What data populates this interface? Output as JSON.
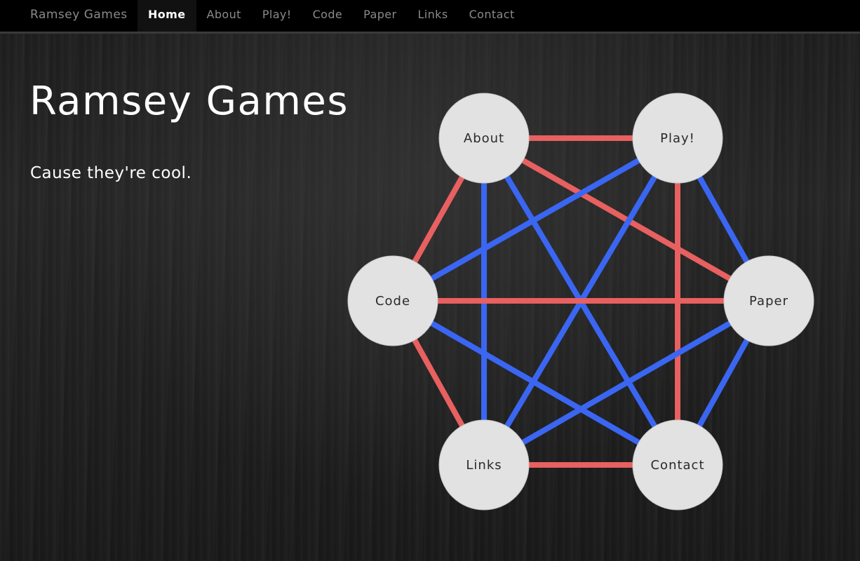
{
  "navbar": {
    "brand": "Ramsey Games",
    "items": [
      {
        "label": "Home",
        "active": true
      },
      {
        "label": "About",
        "active": false
      },
      {
        "label": "Play!",
        "active": false
      },
      {
        "label": "Code",
        "active": false
      },
      {
        "label": "Paper",
        "active": false
      },
      {
        "label": "Links",
        "active": false
      },
      {
        "label": "Contact",
        "active": false
      }
    ]
  },
  "hero": {
    "title": "Ramsey Games",
    "subtitle": "Cause they're cool."
  },
  "colors": {
    "red_edge": "#e86060",
    "blue_edge": "#3a66f2",
    "node_fill": "#e2e2e2"
  },
  "graph": {
    "nodes": [
      {
        "id": "about",
        "label": "About"
      },
      {
        "id": "play",
        "label": "Play!"
      },
      {
        "id": "code",
        "label": "Code"
      },
      {
        "id": "paper",
        "label": "Paper"
      },
      {
        "id": "links",
        "label": "Links"
      },
      {
        "id": "contact",
        "label": "Contact"
      }
    ],
    "edges": [
      {
        "from": "about",
        "to": "play",
        "color": "red"
      },
      {
        "from": "about",
        "to": "paper",
        "color": "red"
      },
      {
        "from": "about",
        "to": "code",
        "color": "red"
      },
      {
        "from": "about",
        "to": "links",
        "color": "blue"
      },
      {
        "from": "about",
        "to": "contact",
        "color": "blue"
      },
      {
        "from": "play",
        "to": "code",
        "color": "blue"
      },
      {
        "from": "play",
        "to": "paper",
        "color": "blue"
      },
      {
        "from": "play",
        "to": "links",
        "color": "blue"
      },
      {
        "from": "play",
        "to": "contact",
        "color": "red"
      },
      {
        "from": "code",
        "to": "paper",
        "color": "red"
      },
      {
        "from": "code",
        "to": "links",
        "color": "red"
      },
      {
        "from": "code",
        "to": "contact",
        "color": "blue"
      },
      {
        "from": "paper",
        "to": "links",
        "color": "blue"
      },
      {
        "from": "paper",
        "to": "contact",
        "color": "blue"
      },
      {
        "from": "links",
        "to": "contact",
        "color": "red"
      }
    ]
  }
}
